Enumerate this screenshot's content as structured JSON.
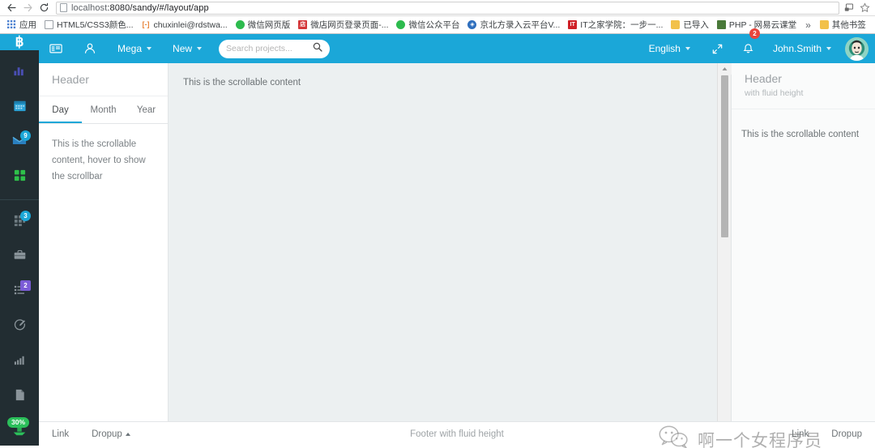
{
  "browser": {
    "back_icon": "back-arrow-icon",
    "forward_icon": "forward-arrow-icon",
    "reload_icon": "reload-icon",
    "url_host": "localhost",
    "url_path": ":8080/sandy/#/layout/app",
    "url_full": "localhost:8080/sandy/#/layout/app",
    "cast_icon": "cast-icon",
    "star_icon": "bookmark-star-icon",
    "apps_label": "应用",
    "overflow_label": "»",
    "bookmarks": [
      {
        "label": "HTML5/CSS3颜色...",
        "icon": "page-icon"
      },
      {
        "label": "chuxinlei@rdstwa...",
        "icon": "mail-icon"
      },
      {
        "label": "微信网页版",
        "icon": "wechat-icon"
      },
      {
        "label": "微店网页登录页面-...",
        "icon": "weidian-icon"
      },
      {
        "label": "微信公众平台",
        "icon": "wechat-icon"
      },
      {
        "label": "京北方录入云平台V...",
        "icon": "cloud-icon"
      },
      {
        "label": "IT之家学院：一步一...",
        "icon": "it-icon"
      },
      {
        "label": "已导入",
        "icon": "folder-icon"
      },
      {
        "label": "PHP - 网易云课堂",
        "icon": "php-icon"
      }
    ],
    "other_bookmarks_label": "其他书签"
  },
  "rail": {
    "brand_label": "฿",
    "items": [
      {
        "name": "analytics",
        "icon": "bar-chart-icon",
        "badge": ""
      },
      {
        "name": "calendar",
        "icon": "calendar-icon",
        "badge": ""
      },
      {
        "name": "messages",
        "icon": "envelope-icon",
        "badge": "9"
      },
      {
        "name": "apps",
        "icon": "grid-icon",
        "badge": ""
      },
      {
        "name": "widgets",
        "icon": "dots-grid-icon",
        "badge": "3"
      },
      {
        "name": "briefcase",
        "icon": "briefcase-icon",
        "badge": ""
      },
      {
        "name": "tasks",
        "icon": "list-icon",
        "badge": "2"
      },
      {
        "name": "edit",
        "icon": "pencil-edit-icon",
        "badge": ""
      },
      {
        "name": "stats",
        "icon": "signal-bars-icon",
        "badge": ""
      },
      {
        "name": "files",
        "icon": "document-icon",
        "badge": ""
      },
      {
        "name": "upload",
        "icon": "upload-icon",
        "badge": "30%"
      }
    ]
  },
  "navbar": {
    "toggle_icon": "sidebar-toggle-icon",
    "user_icon": "user-silhouette-icon",
    "mega_label": "Mega",
    "new_label": "New",
    "search_placeholder": "Search projects...",
    "search_value": "",
    "search_icon": "search-icon",
    "language_label": "English",
    "expand_icon": "expand-arrows-icon",
    "bell_icon": "bell-icon",
    "bell_badge": "2",
    "user_label": "John.Smith",
    "avatar_icon": "avatar-icon"
  },
  "sidebar": {
    "header": "Header",
    "tabs": [
      {
        "label": "Day",
        "active": true
      },
      {
        "label": "Month",
        "active": false
      },
      {
        "label": "Year",
        "active": false
      }
    ],
    "body": "This is the scrollable content, hover to show the scrollbar"
  },
  "main": {
    "text": "This is the scrollable content",
    "scrollbar_up_icon": "scroll-up-arrow-icon"
  },
  "right_panel": {
    "title": "Header",
    "subtitle": "with fluid height",
    "body": "This is the scrollable content"
  },
  "footer": {
    "left_link": "Link",
    "left_dropup": "Dropup",
    "center": "Footer with fluid height",
    "right_link": "Link",
    "right_dropup": "Dropup"
  },
  "watermark": {
    "icon": "wechat-logo-icon",
    "text": "啊一个女程序员"
  },
  "colors": {
    "brand_blue": "#1ba7d8",
    "rail_dark": "#222d32",
    "content_gray": "#ecf0f1",
    "badge_red": "#e8453c",
    "badge_green": "#2bbf5a",
    "badge_purple": "#7b5cd6"
  }
}
